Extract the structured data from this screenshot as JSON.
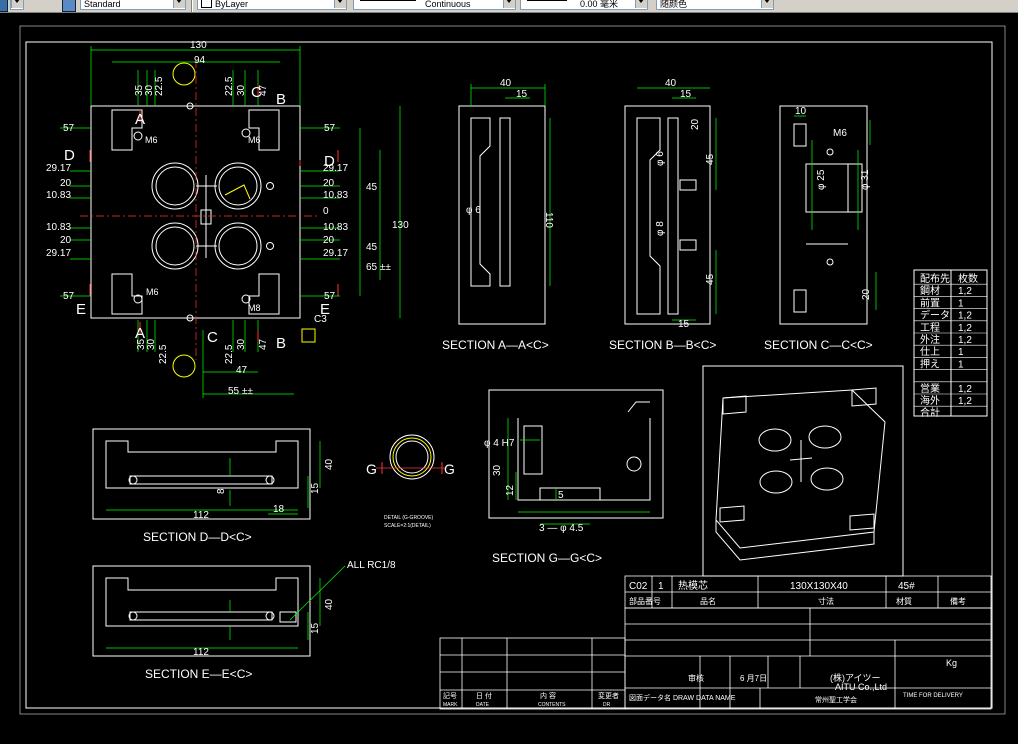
{
  "toolbar": {
    "text_style": "Standard",
    "layer_color": "ByLayer",
    "linetype": "Continuous",
    "lineweight": "0.00 毫米",
    "plot_style": "随颜色"
  },
  "dims": {
    "width_130": "130",
    "d94": "94",
    "v35": "35",
    "v30": "30",
    "v225": "22.5",
    "v225b": "22.5",
    "v30b": "30",
    "v47": "47",
    "r57": "57",
    "r2917": "29.17",
    "r20": "20",
    "r1083": "10.83",
    "r0": "0",
    "r45": "45",
    "r130": "130",
    "r65": "65 ±±",
    "m6": "M6",
    "m8": "M8",
    "c3": "C3",
    "b47": "47",
    "b55": "55 ±±",
    "sec_a_40": "40",
    "sec_a_15": "15",
    "sec_a_110": "110",
    "sec_a_phi6": "φ 6",
    "sec_b_40": "40",
    "sec_b_15": "15",
    "sec_b_20": "20",
    "sec_b_45": "45",
    "sec_b_45b": "45",
    "sec_b_15b": "15",
    "sec_b_phi6": "φ 6",
    "sec_b_phi8": "φ 8",
    "sec_c_10": "10",
    "sec_c_m6": "M6",
    "sec_c_phi25": "φ 25",
    "sec_c_phi31": "φ 31",
    "sec_c_20": "20",
    "sec_d_40": "40",
    "sec_d_15": "15",
    "sec_d_112": "112",
    "sec_d_18": "18",
    "sec_d_8": "8",
    "sec_e_40": "40",
    "sec_e_15": "15",
    "sec_e_112": "112",
    "sec_e_rc": "ALL RC1/8",
    "sec_g_phi4": "φ 4 H7",
    "sec_g_30": "30",
    "sec_g_12": "12",
    "sec_g_5": "5",
    "sec_g_3": "3 — φ 4.5"
  },
  "labels": {
    "section_aa": "SECTION A—A<C>",
    "section_bb": "SECTION B—B<C>",
    "section_cc": "SECTION C—C<C>",
    "section_dd": "SECTION D—D<C>",
    "section_ee": "SECTION E—E<C>",
    "section_gg": "SECTION G—G<C>",
    "detail_note": "DETAIL (G-GROOVE)",
    "scale_note": "SCALE=2:1(DETAIL)"
  },
  "parts_table": {
    "header": [
      "配布先",
      "枚数"
    ],
    "rows": [
      [
        "鋼材",
        "1,2"
      ],
      [
        "前置",
        "1"
      ],
      [
        "データ",
        "1,2"
      ],
      [
        "工程",
        "1,2"
      ],
      [
        "外注",
        "1,2"
      ],
      [
        "仕上",
        "1"
      ],
      [
        "押え",
        "1"
      ],
      [
        "",
        ""
      ],
      [
        "営業",
        "1,2"
      ],
      [
        "海外",
        "1,2"
      ],
      [
        "合計",
        ""
      ]
    ]
  },
  "title_block": {
    "part_no": "C02",
    "qty": "1",
    "name": "热模芯",
    "size": "130X130X40",
    "material": "45#",
    "company": "(株)アイツー",
    "company_en": "AITU Co.,Ltd",
    "date": "6 月7日",
    "checker": "审核",
    "col_part_no": "部品番号",
    "col_name": "品名",
    "col_size": "寸法",
    "col_material": "材質",
    "col_note": "備考",
    "unit": "Kg",
    "time_for_delivery": "TIME FOR DELIVERY",
    "drawing_name_label": "図面データ名 DRAW DATA NAME",
    "author": "常州聖工学会"
  },
  "revision": {
    "headers": [
      "記号",
      "日 付",
      "内 容",
      "変更者"
    ],
    "headers_en": [
      "MARK",
      "DATE",
      "CONTENTS",
      "DR"
    ]
  },
  "colors": {
    "background": "#000000",
    "line": "#ffffff",
    "dimension": "#00ff00",
    "yellow": "#ffff00",
    "red": "#ff0000",
    "cyan": "#00ffff"
  }
}
